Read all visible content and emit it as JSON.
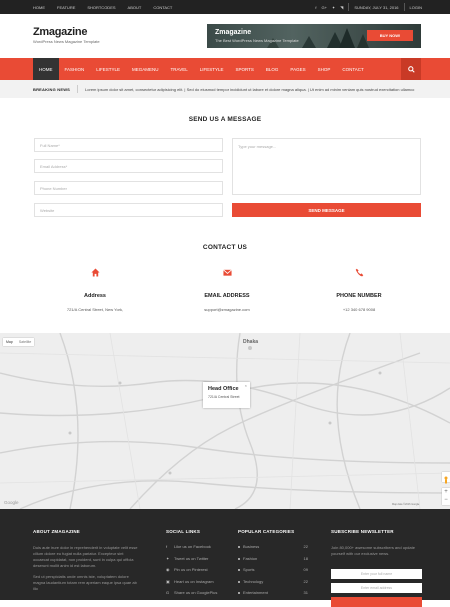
{
  "topbar": {
    "menu": [
      "HOME",
      "FEATURE",
      "SHORTCODES",
      "ABOUT",
      "CONTACT"
    ],
    "social_icons": [
      "facebook-icon",
      "google-plus-icon",
      "twitter-icon",
      "rss-icon"
    ],
    "date": "SUNDAY, JULY 31, 2016",
    "login": "LOGIN"
  },
  "header": {
    "logo": "Zmagazine",
    "tagline": "WordPress News Magazine Template",
    "ad_title": "Zmagazine",
    "ad_subtitle": "The Best WordPress News Magazine Template",
    "ad_button": "BUY NOW!"
  },
  "nav": {
    "items": [
      "HOME",
      "FASHION",
      "LIFESTYLE",
      "MEGAMENU",
      "TRAVEL",
      "LIFESTYLE",
      "SPORTS",
      "BLOG",
      "PAGES",
      "SHOP",
      "CONTACT"
    ],
    "active_index": 0
  },
  "breaking": {
    "label": "BREAKING NEWS",
    "text": "Lorem ipsum dolor sit amet, consectetur adipisicing elit. | Sed do eiusmod tempor incididunt ut labore et dolore magna aliqua. | Ut enim ad minim veniam quis nostrud exercitation ullamco laboris | Sed do eiusmod tempor incididunt ut labore et dolore magna aliqua."
  },
  "send": {
    "heading": "SEND US A MESSAGE",
    "full_name": "Full Name*",
    "email": "Email Address*",
    "phone": "Phone Number",
    "website": "Website",
    "message": "Type your message...",
    "button": "SEND MESSAGE"
  },
  "contact": {
    "heading": "CONTACT US",
    "cols": [
      {
        "icon": "home-icon",
        "title": "Address",
        "value": "721/A Central Street, New York,"
      },
      {
        "icon": "envelope-icon",
        "title": "EMAIL ADDRESS",
        "value": "support@zmagazine.com"
      },
      {
        "icon": "phone-icon",
        "title": "PHONE NUMBER",
        "value": "+12 340 678 9008"
      }
    ]
  },
  "map": {
    "tab_map": "Map",
    "tab_sat": "Satellite",
    "city": "Dhaka",
    "popup_title": "Head Office",
    "popup_sub": "721/A Central Street",
    "attribution": "Map data ©2016 Google",
    "google": "Google"
  },
  "footer": {
    "about_title": "ABOUT ZMAGAZINE",
    "about_text1": "Duis aute irure dolor in reprehenderit in voluptate velit esse cillum dolore eu fugiat nulla pariatur. Excepteur sint occaecat cupidatat, non proident, sunt in culpa qui officia deserunt mollit anim id est laborum.",
    "about_text2": "Sed ut perspiciatis unde omnis iste, voluptatem dolore magna laudantium totam rem aperiam eaque ipsa quae ab illo",
    "social_title": "SOCIAL LINKS",
    "social": [
      {
        "icon": "facebook-icon",
        "label": "Like us on Facebook"
      },
      {
        "icon": "twitter-icon",
        "label": "Tweet us on Twitter"
      },
      {
        "icon": "pinterest-icon",
        "label": "Pin us on Pinterest"
      },
      {
        "icon": "instagram-icon",
        "label": "Heart us on Instagram"
      },
      {
        "icon": "google-plus-icon",
        "label": "Share us on GooglePlus"
      }
    ],
    "cats_title": "POPULAR CATEGORIES",
    "cats": [
      {
        "name": "Business",
        "count": "22"
      },
      {
        "name": "Fashion",
        "count": "18"
      },
      {
        "name": "Sports",
        "count": "09"
      },
      {
        "name": "Technology",
        "count": "22"
      },
      {
        "name": "Entertainment",
        "count": "31"
      }
    ],
    "news_title": "SUBSCRIBE NEWSLETTER",
    "news_text": "Join 80,000+ awesome subscribers and update yourself with our exclusive news.",
    "news_name": "Enter your full name",
    "news_email": "Enter email address"
  },
  "colors": {
    "accent": "#e94b35",
    "dark": "#222222"
  }
}
